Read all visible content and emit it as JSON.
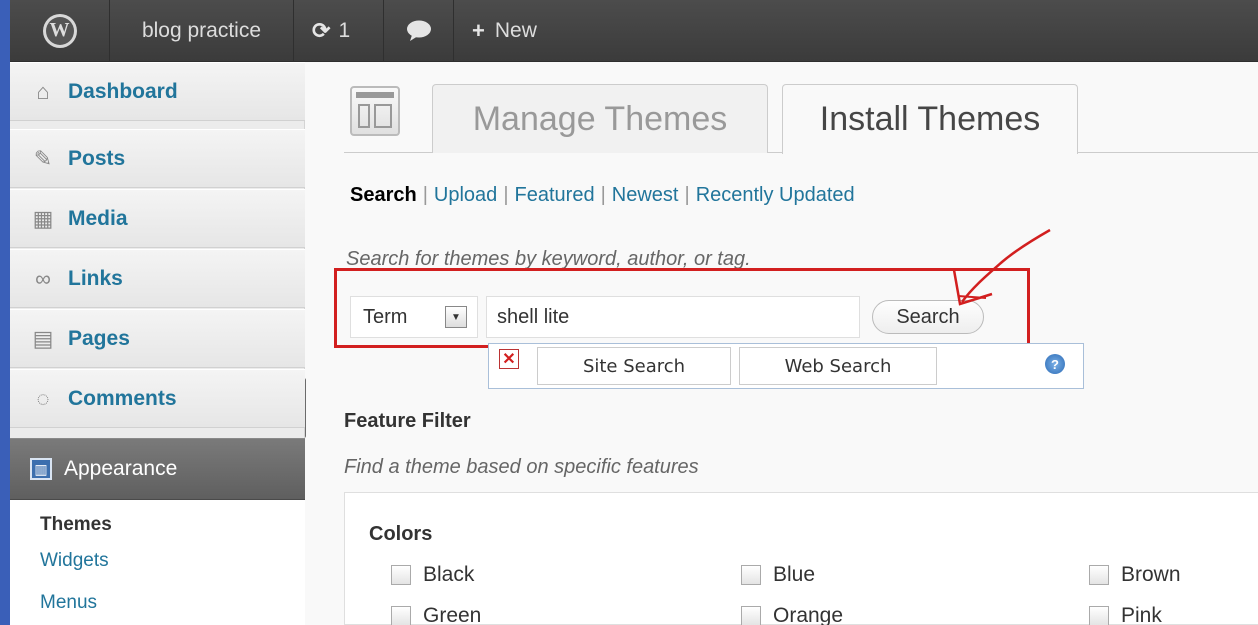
{
  "admin_bar": {
    "logo_glyph": "W",
    "site_name": "blog practice",
    "updates_count": "1",
    "new_label": "New"
  },
  "sidebar": {
    "items": [
      {
        "label": "Dashboard",
        "icon": "home-icon"
      },
      {
        "label": "Posts",
        "icon": "pushpin-icon"
      },
      {
        "label": "Media",
        "icon": "media-icon"
      },
      {
        "label": "Links",
        "icon": "link-icon"
      },
      {
        "label": "Pages",
        "icon": "pages-icon"
      },
      {
        "label": "Comments",
        "icon": "comment-icon"
      },
      {
        "label": "Appearance",
        "icon": "appearance-icon"
      }
    ],
    "submenu": [
      "Themes",
      "Widgets",
      "Menus"
    ]
  },
  "tabs": {
    "manage": "Manage Themes",
    "install": "Install Themes"
  },
  "subnav": {
    "search": "Search",
    "upload": "Upload",
    "featured": "Featured",
    "newest": "Newest",
    "recent": "Recently Updated"
  },
  "search": {
    "hint": "Search for themes by keyword, author, or tag.",
    "type_selected": "Term",
    "term_value": "shell lite",
    "button": "Search"
  },
  "popup": {
    "site_search": "Site Search",
    "web_search": "Web Search"
  },
  "filter": {
    "heading": "Feature Filter",
    "description": "Find a theme based on specific features",
    "colors_title": "Colors",
    "colors": [
      "Black",
      "Blue",
      "Brown",
      "Green",
      "Orange",
      "Pink"
    ]
  },
  "colors": {
    "link": "#21759b",
    "annotation_red": "#d21f1f",
    "admin_bar": "#464646"
  }
}
